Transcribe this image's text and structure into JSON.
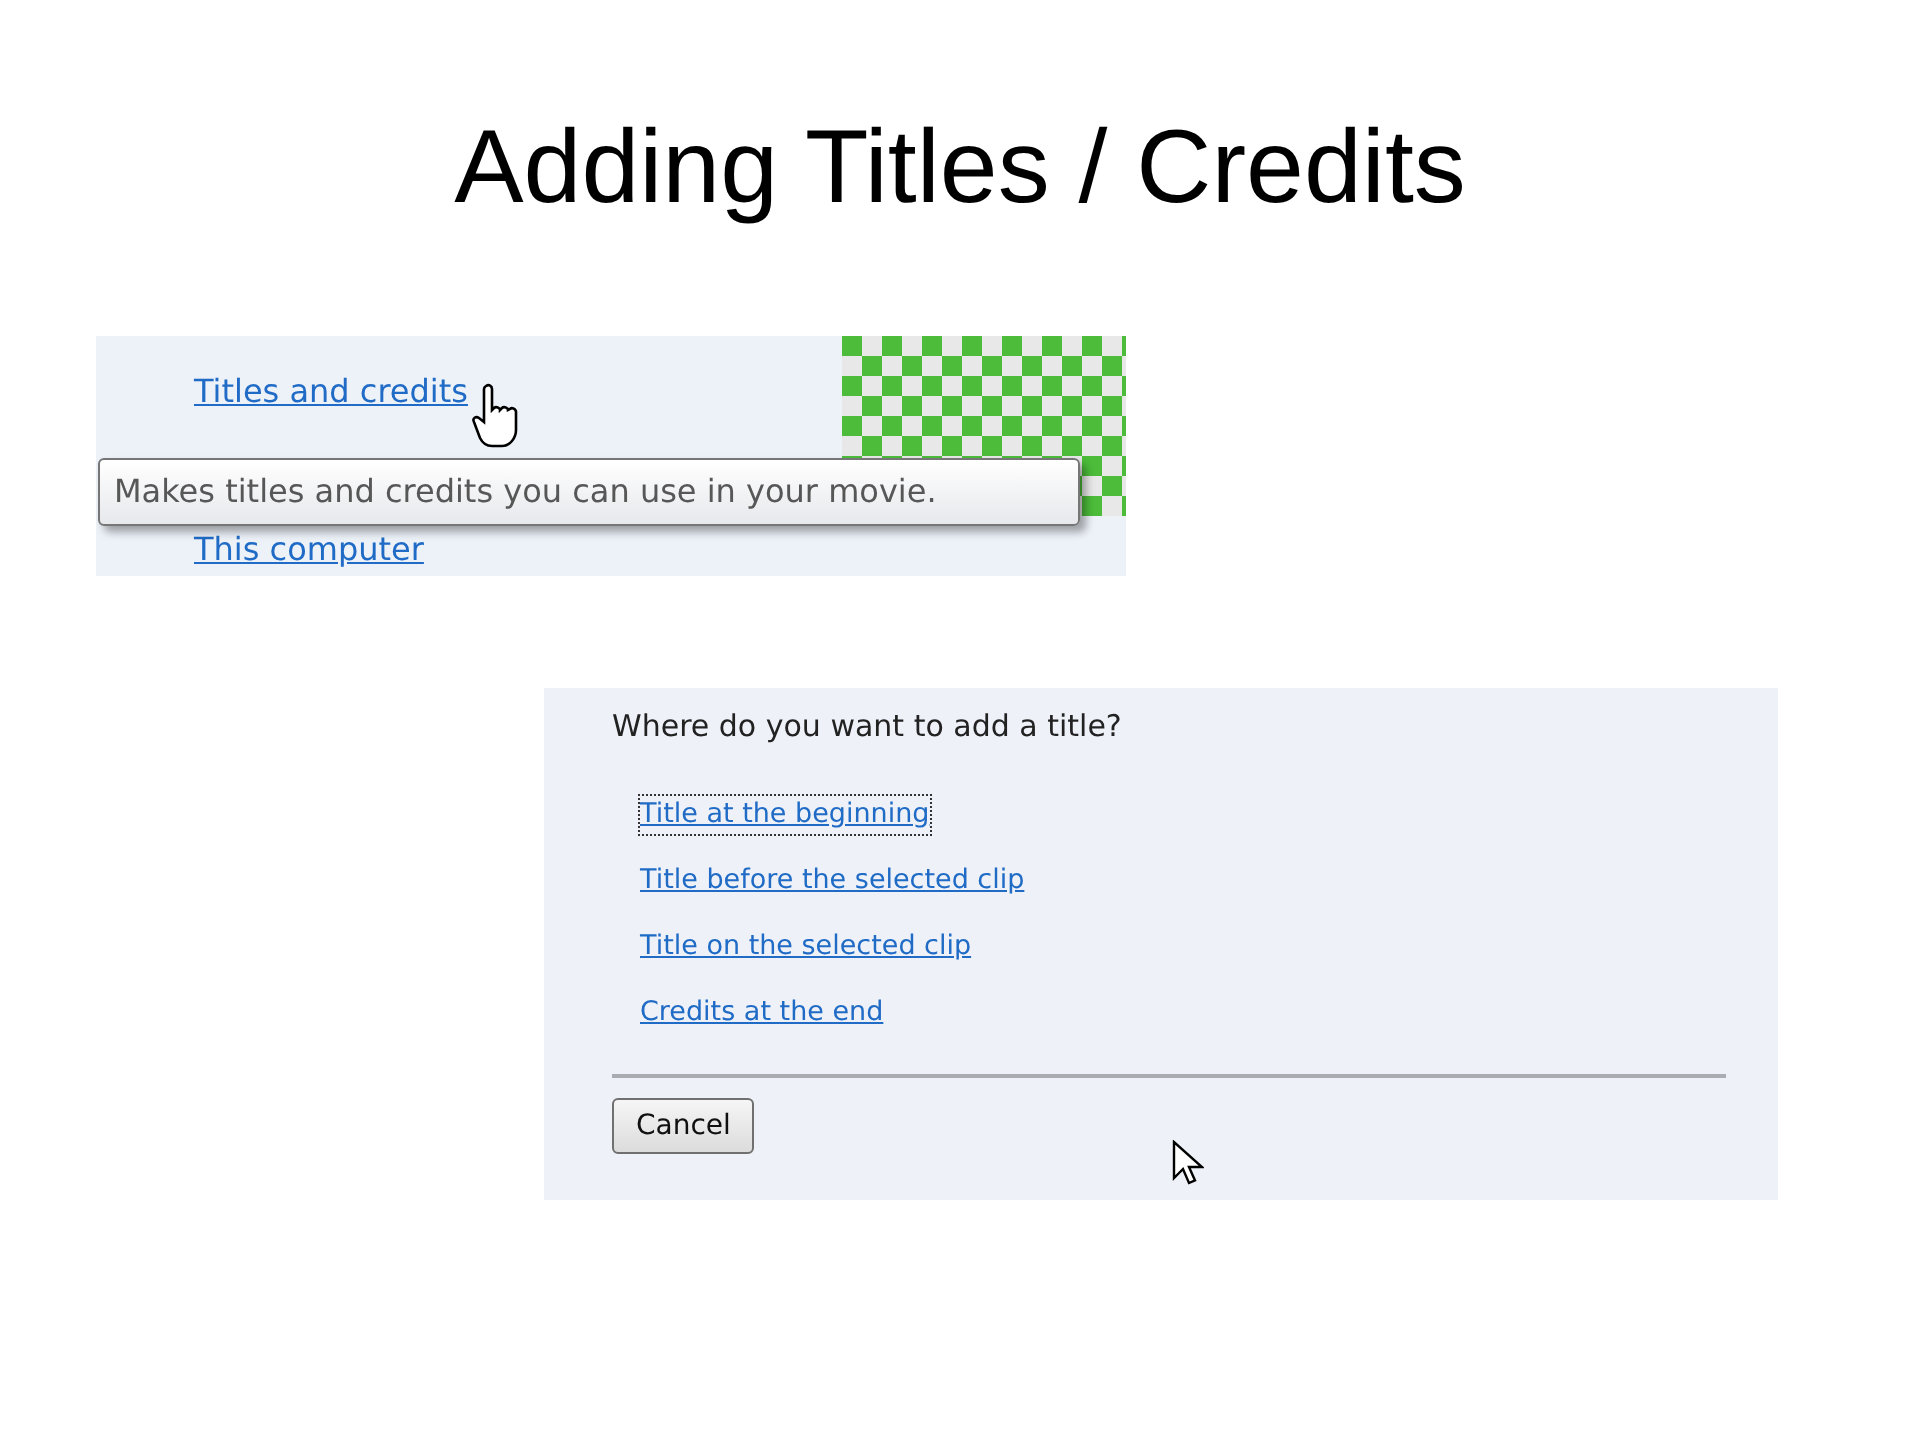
{
  "slide": {
    "title": "Adding Titles / Credits"
  },
  "panel_1": {
    "link": "Titles and credits",
    "tooltip": "Makes titles and credits you can use in your movie.",
    "next_link": "This computer"
  },
  "panel_2": {
    "question": "Where do you want to add a title?",
    "options": [
      {
        "label": "Title at the beginning",
        "focused": true
      },
      {
        "label": "Title before the selected clip",
        "focused": false
      },
      {
        "label": "Title on the selected clip",
        "focused": false
      },
      {
        "label": "Credits at the end",
        "focused": false
      }
    ],
    "buttons": [
      "Cancel"
    ]
  }
}
